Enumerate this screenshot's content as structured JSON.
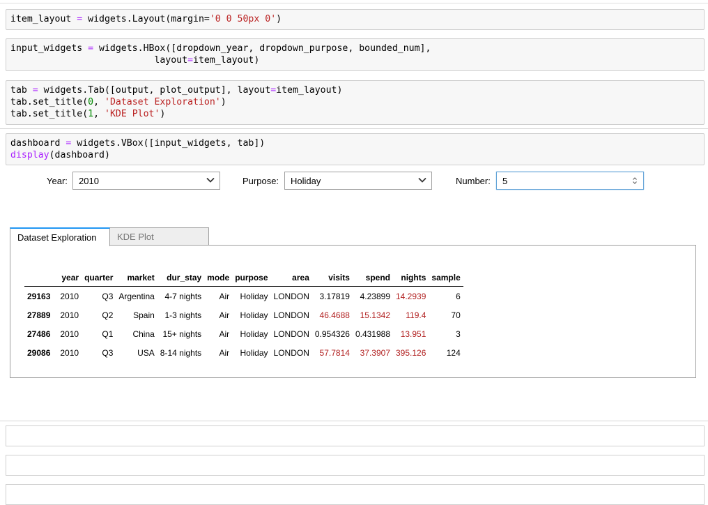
{
  "cells": [
    {
      "lines": [
        [
          [
            "t",
            "item_layout "
          ],
          [
            "o",
            "="
          ],
          [
            "t",
            " widgets.Layout(margin="
          ],
          [
            "s",
            "'0 0 50px 0'"
          ],
          [
            "t",
            ")"
          ]
        ]
      ]
    },
    {
      "lines": [
        [
          [
            "t",
            "input_widgets "
          ],
          [
            "o",
            "="
          ],
          [
            "t",
            " widgets.HBox([dropdown_year, dropdown_purpose, bounded_num],"
          ]
        ],
        [
          [
            "t",
            "                          layout"
          ],
          [
            "o",
            "="
          ],
          [
            "t",
            "item_layout)"
          ]
        ]
      ]
    },
    {
      "lines": [
        [
          [
            "t",
            "tab "
          ],
          [
            "o",
            "="
          ],
          [
            "t",
            " widgets.Tab([output, plot_output], layout"
          ],
          [
            "o",
            "="
          ],
          [
            "t",
            "item_layout)"
          ]
        ],
        [
          [
            "t",
            "tab.set_title("
          ],
          [
            "n",
            "0"
          ],
          [
            "t",
            ", "
          ],
          [
            "s",
            "'Dataset Exploration'"
          ],
          [
            "t",
            ")"
          ]
        ],
        [
          [
            "t",
            "tab.set_title("
          ],
          [
            "n",
            "1"
          ],
          [
            "t",
            ", "
          ],
          [
            "s",
            "'KDE Plot'"
          ],
          [
            "t",
            ")"
          ]
        ]
      ]
    },
    {
      "lines": [
        [
          [
            "t",
            "dashboard "
          ],
          [
            "o",
            "="
          ],
          [
            "t",
            " widgets.VBox([input_widgets, tab])"
          ]
        ],
        [
          [
            "k",
            "display"
          ],
          [
            "t",
            "(dashboard)"
          ]
        ]
      ]
    }
  ],
  "widgets": {
    "year": {
      "label": "Year:",
      "value": "2010"
    },
    "purpose": {
      "label": "Purpose:",
      "value": "Holiday"
    },
    "number": {
      "label": "Number:",
      "value": "5"
    }
  },
  "tabs": [
    {
      "label": "Dataset Exploration",
      "active": true
    },
    {
      "label": "KDE Plot",
      "active": false
    }
  ],
  "table": {
    "columns": [
      "year",
      "quarter",
      "market",
      "dur_stay",
      "mode",
      "purpose",
      "area",
      "visits",
      "spend",
      "nights",
      "sample"
    ],
    "rows": [
      {
        "index": "29163",
        "cells": [
          "2010",
          "Q3",
          "Argentina",
          "4-7 nights",
          "Air",
          "Holiday",
          "LONDON",
          "3.17819",
          "4.23899",
          "14.2939",
          "6"
        ],
        "highlight": [
          false,
          false,
          false,
          false,
          false,
          false,
          false,
          false,
          false,
          true,
          false
        ]
      },
      {
        "index": "27889",
        "cells": [
          "2010",
          "Q2",
          "Spain",
          "1-3 nights",
          "Air",
          "Holiday",
          "LONDON",
          "46.4688",
          "15.1342",
          "119.4",
          "70"
        ],
        "highlight": [
          false,
          false,
          false,
          false,
          false,
          false,
          false,
          true,
          true,
          true,
          false
        ]
      },
      {
        "index": "27486",
        "cells": [
          "2010",
          "Q1",
          "China",
          "15+ nights",
          "Air",
          "Holiday",
          "LONDON",
          "0.954326",
          "0.431988",
          "13.951",
          "3"
        ],
        "highlight": [
          false,
          false,
          false,
          false,
          false,
          false,
          false,
          false,
          false,
          true,
          false
        ]
      },
      {
        "index": "29086",
        "cells": [
          "2010",
          "Q3",
          "USA",
          "8-14 nights",
          "Air",
          "Holiday",
          "LONDON",
          "57.7814",
          "37.3907",
          "395.126",
          "124"
        ],
        "highlight": [
          false,
          false,
          false,
          false,
          false,
          false,
          false,
          true,
          true,
          true,
          false
        ]
      }
    ]
  },
  "colors": {
    "keyword": "#aa22ff",
    "string": "#ba2121",
    "number": "#008800",
    "highlight": "#b22222",
    "tab_accent": "#2196f3"
  }
}
